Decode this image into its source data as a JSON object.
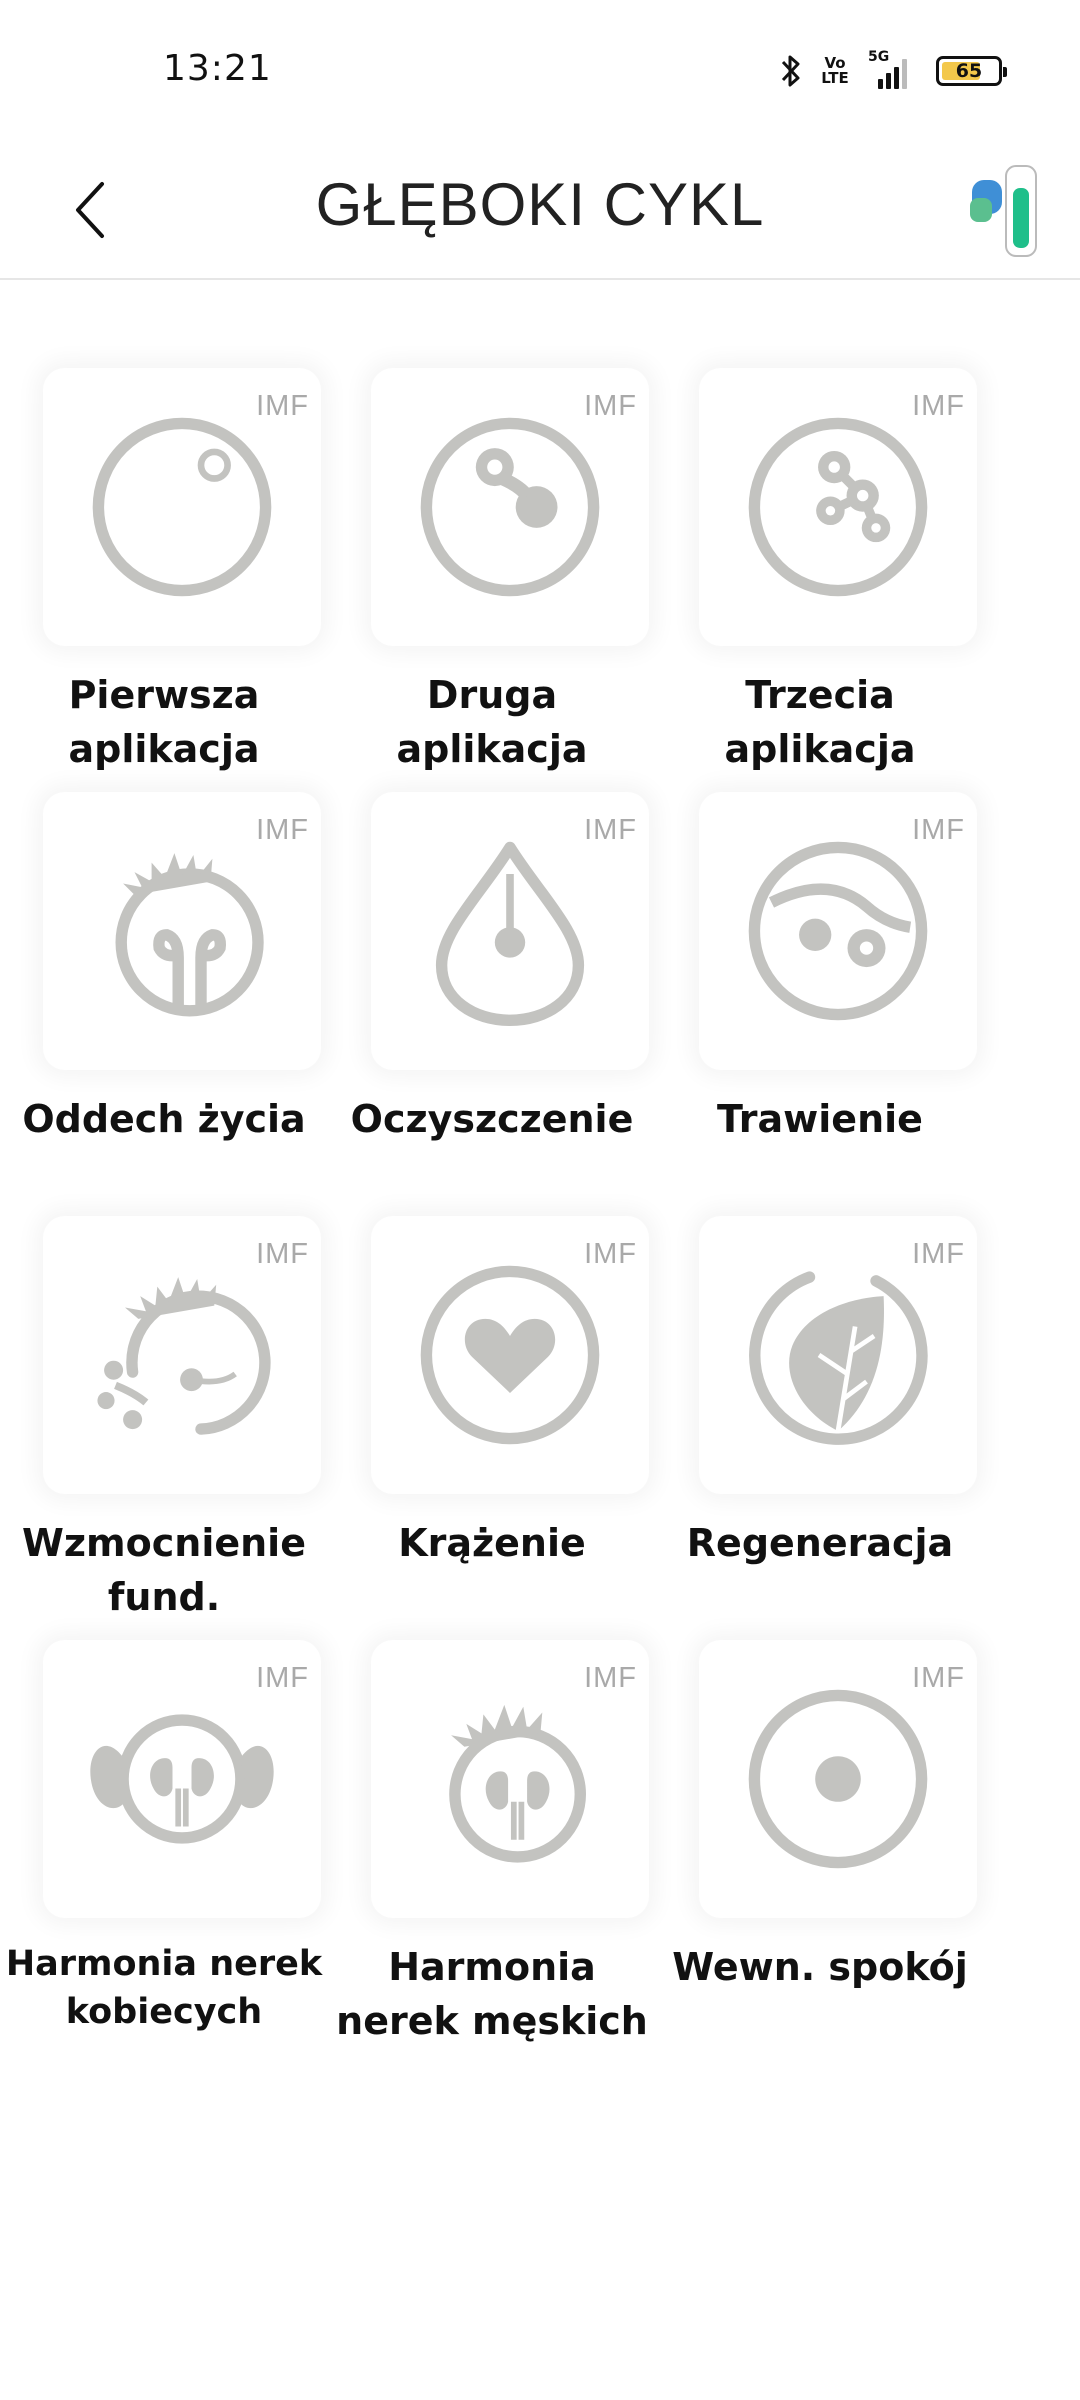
{
  "status_bar": {
    "time": "13:21",
    "icons": [
      "bluetooth-icon",
      "volte-icon",
      "5g-signal-icon",
      "battery-icon"
    ],
    "volte_label": "Vo LTE",
    "network_label": "5G",
    "battery_level": "65"
  },
  "header": {
    "back_icon": "chevron-left-icon",
    "title": "GŁĘBOKI CYKL",
    "device_icon": "device-icon"
  },
  "colors": {
    "icon_gray": "#c3c3c0",
    "badge_gray": "#a9a9a9",
    "card_bg": "#ffffff",
    "battery_fill": "#f3c84b"
  },
  "programs": [
    {
      "label": "Pierwsza aplikacja",
      "badge": "IMF",
      "icon": "circle-with-dot-icon"
    },
    {
      "label": "Druga aplikacja",
      "badge": "IMF",
      "icon": "circle-two-cells-icon"
    },
    {
      "label": "Trzecia aplikacja",
      "badge": "IMF",
      "icon": "circle-cell-division-icon"
    },
    {
      "label": "Oddech życia",
      "badge": "IMF",
      "icon": "lungs-sun-icon"
    },
    {
      "label": "Oczyszczenie",
      "badge": "IMF",
      "icon": "drop-icon"
    },
    {
      "label": "Trawienie",
      "badge": "IMF",
      "icon": "digestion-icon"
    },
    {
      "label": "Wzmocnienie fund.",
      "badge": "IMF",
      "icon": "spiky-circle-sperm-icon"
    },
    {
      "label": "Krążenie",
      "badge": "IMF",
      "icon": "heart-circle-icon"
    },
    {
      "label": "Regeneracja",
      "badge": "IMF",
      "icon": "leaf-circle-icon"
    },
    {
      "label": "Harmonia nerek kobiecych",
      "badge": "IMF",
      "icon": "kidneys-female-icon"
    },
    {
      "label": "Harmonia nerek męskich",
      "badge": "IMF",
      "icon": "kidneys-male-icon"
    },
    {
      "label": "Wewn. spokój",
      "badge": "IMF",
      "icon": "circle-center-dot-icon"
    }
  ]
}
